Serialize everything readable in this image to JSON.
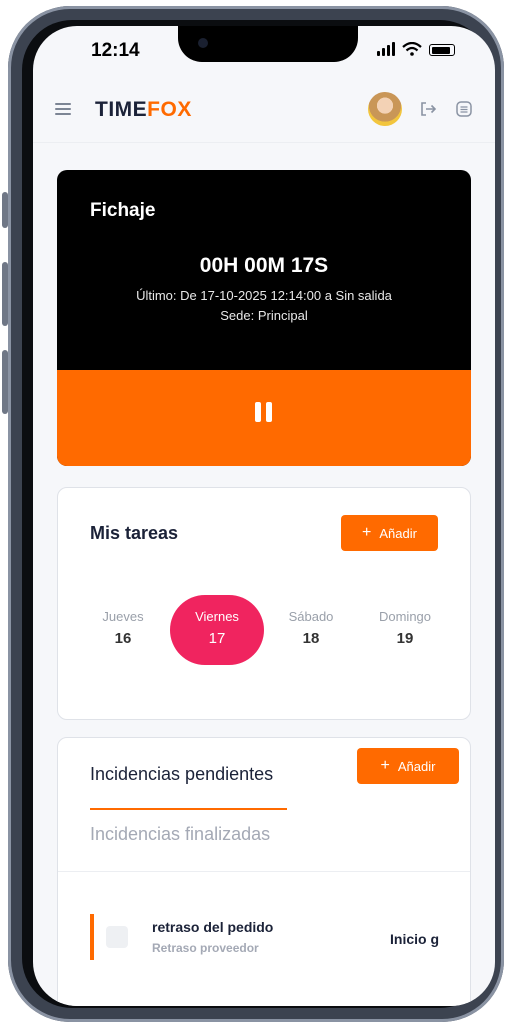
{
  "status": {
    "time": "12:14"
  },
  "header": {
    "logo_part1": "TIME",
    "logo_part2": "FOX"
  },
  "fichaje": {
    "title": "Fichaje",
    "timer": "00H 00M 17S",
    "ultimo": "Último: De 17-10-2025 12:14:00 a Sin salida",
    "sede": "Sede: Principal"
  },
  "tareas": {
    "title": "Mis tareas",
    "add_label": "Añadir",
    "days": [
      {
        "name": "Jueves",
        "num": "16"
      },
      {
        "name": "Viernes",
        "num": "17"
      },
      {
        "name": "Sábado",
        "num": "18"
      },
      {
        "name": "Domingo",
        "num": "19"
      }
    ]
  },
  "incidencias": {
    "tab_pending": "Incidencias pendientes",
    "tab_finished": "Incidencias finalizadas",
    "add_label": "Añadir",
    "items": [
      {
        "title": "retraso del pedido",
        "subtitle": "Retraso proveedor",
        "right": "Inicio g"
      }
    ]
  },
  "colors": {
    "accent": "#ff6a00",
    "active_day": "#f0245f",
    "dark": "#000000"
  }
}
